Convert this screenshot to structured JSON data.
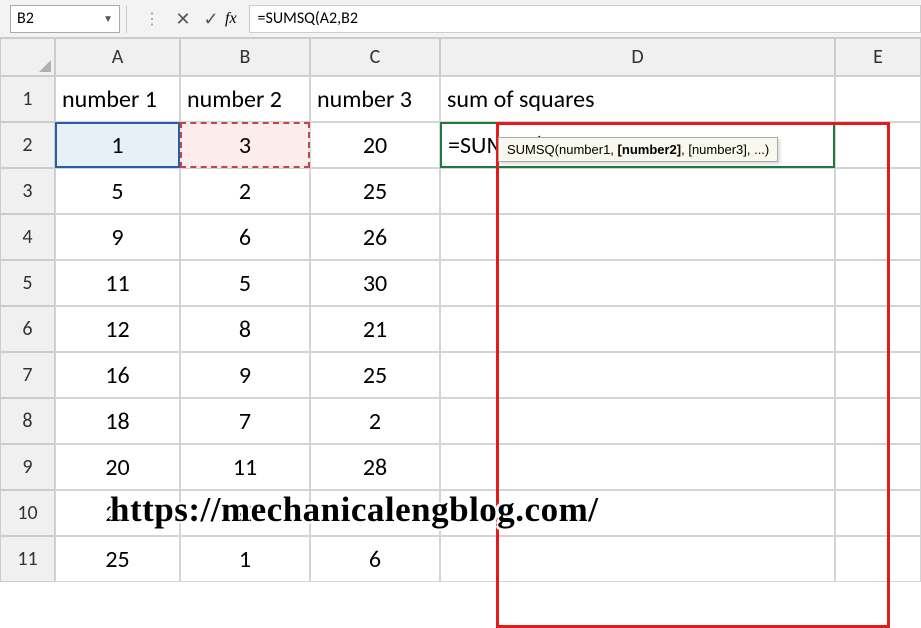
{
  "namebox": {
    "value": "B2"
  },
  "formula_bar": {
    "text": "=SUMSQ(A2,B2"
  },
  "columns": [
    "A",
    "B",
    "C",
    "D",
    "E"
  ],
  "rows": [
    "1",
    "2",
    "3",
    "4",
    "5",
    "6",
    "7",
    "8",
    "9",
    "10",
    "11"
  ],
  "headers_row": {
    "A": "number 1",
    "B": "number 2",
    "C": "number 3",
    "D": "sum of squares"
  },
  "editing_formula": {
    "prefix": "=SUMSQ(",
    "arg1": "A2",
    "comma": ",",
    "arg2": "B2"
  },
  "tooltip": {
    "prefix": "SUMSQ(number1, ",
    "bold": "[number2]",
    "suffix": ", [number3], ...)"
  },
  "watermark": "https://mechanicalengblog.com/",
  "chart_data": {
    "type": "table",
    "title": "sum of squares",
    "columns": [
      "number 1",
      "number 2",
      "number 3",
      "sum of squares"
    ],
    "rows": [
      {
        "number 1": 1,
        "number 2": 3,
        "number 3": 20,
        "sum of squares": "=SUMSQ(A2,B2"
      },
      {
        "number 1": 5,
        "number 2": 2,
        "number 3": 25
      },
      {
        "number 1": 9,
        "number 2": 6,
        "number 3": 26
      },
      {
        "number 1": 11,
        "number 2": 5,
        "number 3": 30
      },
      {
        "number 1": 12,
        "number 2": 8,
        "number 3": 21
      },
      {
        "number 1": 16,
        "number 2": 9,
        "number 3": 25
      },
      {
        "number 1": 18,
        "number 2": 7,
        "number 3": 2
      },
      {
        "number 1": 20,
        "number 2": 11,
        "number 3": 28
      },
      {
        "number 1": 22,
        "number 2": 20,
        "number 3": 3
      },
      {
        "number 1": 25,
        "number 2": 1,
        "number 3": 6
      }
    ]
  },
  "cells": {
    "r3": {
      "A": "5",
      "B": "2",
      "C": "25"
    },
    "r4": {
      "A": "9",
      "B": "6",
      "C": "26"
    },
    "r5": {
      "A": "11",
      "B": "5",
      "C": "30"
    },
    "r6": {
      "A": "12",
      "B": "8",
      "C": "21"
    },
    "r7": {
      "A": "16",
      "B": "9",
      "C": "25"
    },
    "r8": {
      "A": "18",
      "B": "7",
      "C": "2"
    },
    "r9": {
      "A": "20",
      "B": "11",
      "C": "28"
    },
    "r10": {
      "A": "22",
      "B": "20",
      "C": "3"
    },
    "r11": {
      "A": "25",
      "B": "1",
      "C": "6"
    },
    "r2": {
      "A": "1",
      "B": "3",
      "C": "20"
    }
  }
}
